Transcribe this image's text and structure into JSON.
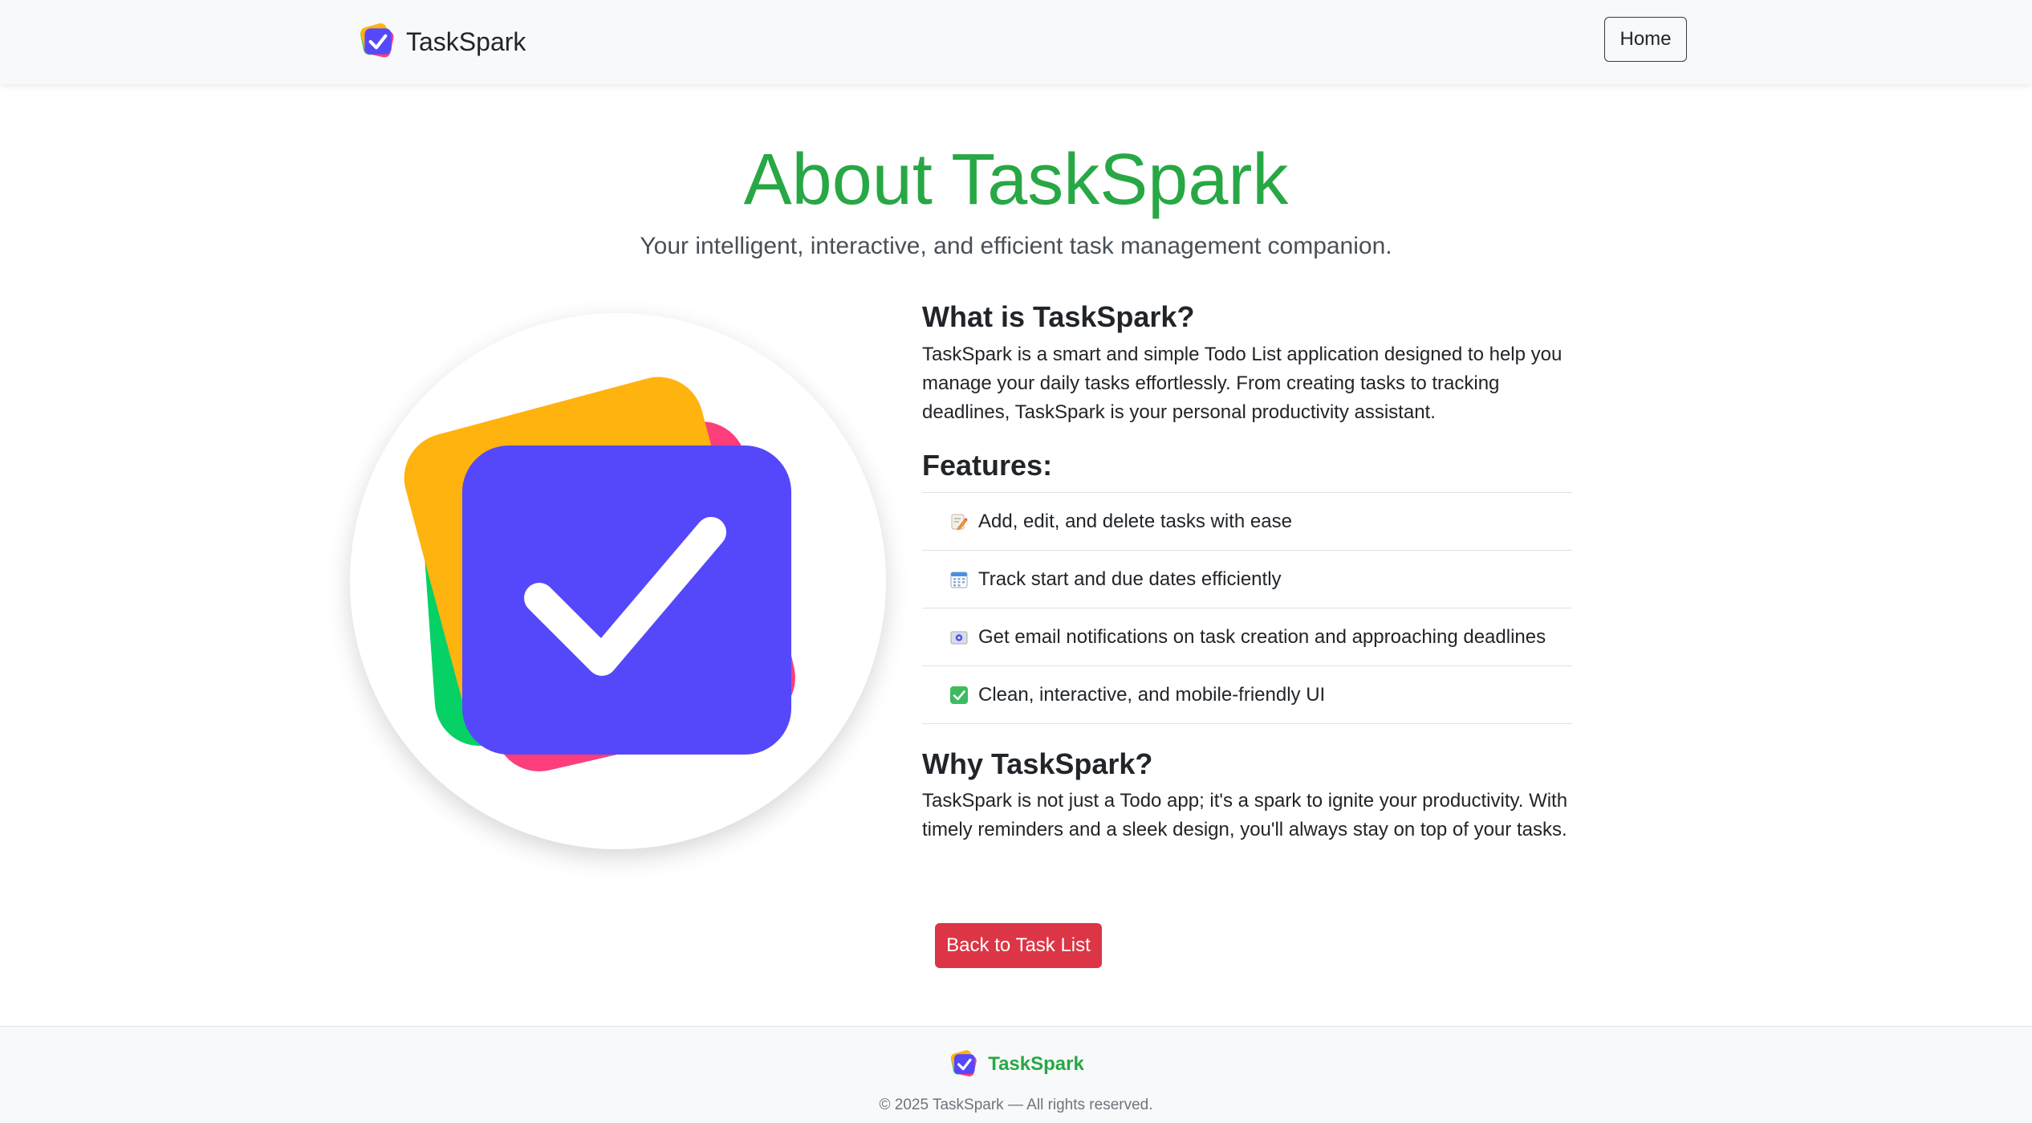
{
  "navbar": {
    "brand_name": "TaskSpark",
    "home_label": "Home"
  },
  "hero": {
    "title": "About TaskSpark",
    "subtitle": "Your intelligent, interactive, and efficient task management companion."
  },
  "about": {
    "what_title": "What is TaskSpark?",
    "what_body": "TaskSpark is a smart and simple Todo List application designed to help you manage your daily tasks effortlessly. From creating tasks to tracking deadlines, TaskSpark is your personal productivity assistant.",
    "features_title": "Features:",
    "features": [
      {
        "icon": "memo-icon",
        "text": "Add, edit, and delete tasks with ease"
      },
      {
        "icon": "calendar-icon",
        "text": "Track start and due dates efficiently"
      },
      {
        "icon": "email-icon",
        "text": "Get email notifications on task creation and approaching deadlines"
      },
      {
        "icon": "check-mark-icon",
        "text": "Clean, interactive, and mobile-friendly UI"
      }
    ],
    "why_title": "Why TaskSpark?",
    "why_body": "TaskSpark is not just a Todo app; it's a spark to ignite your productivity. With timely reminders and a sleek design, you'll always stay on top of your tasks."
  },
  "actions": {
    "back_label": "Back to Task List"
  },
  "footer": {
    "brand_name": "TaskSpark",
    "copyright": "© 2025 TaskSpark — All rights reserved."
  },
  "colors": {
    "accent_green": "#28a745",
    "danger_red": "#dc3545",
    "logo_purple": "#5548fb",
    "logo_orange": "#ffb30f",
    "logo_green": "#05d165",
    "logo_pink": "#fc3e7a"
  }
}
